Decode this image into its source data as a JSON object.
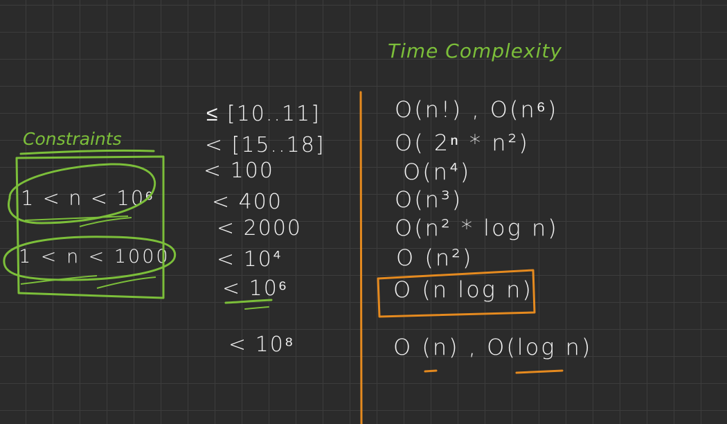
{
  "heading": "Time Complexity",
  "constraints": {
    "label": "Constraints",
    "examples": [
      "1 < n < 10⁶",
      "1 < n < 1000"
    ]
  },
  "rows": [
    {
      "n_limit": "≤ [10..11]",
      "complexity": "O(n!) , O(n⁶)"
    },
    {
      "n_limit": "< [15..18]",
      "complexity": "O( 2ⁿ * n²)"
    },
    {
      "n_limit": "< 100",
      "complexity": "O(n⁴)"
    },
    {
      "n_limit": "< 400",
      "complexity": "O(n³)"
    },
    {
      "n_limit": "< 2000",
      "complexity": "O(n² * log n)"
    },
    {
      "n_limit": "< 10⁴",
      "complexity": "O (n²)"
    },
    {
      "n_limit": "< 10⁶",
      "complexity": "O (n log n)"
    },
    {
      "n_limit": "< 10⁸",
      "complexity": "O (n) , O(log n)"
    }
  ],
  "colors": {
    "background": "#2b2b2b",
    "grid": "#3d3d3d",
    "ink_white": "#f4f4f4",
    "ink_green": "#7cbf3a",
    "ink_orange": "#e58a1f"
  }
}
